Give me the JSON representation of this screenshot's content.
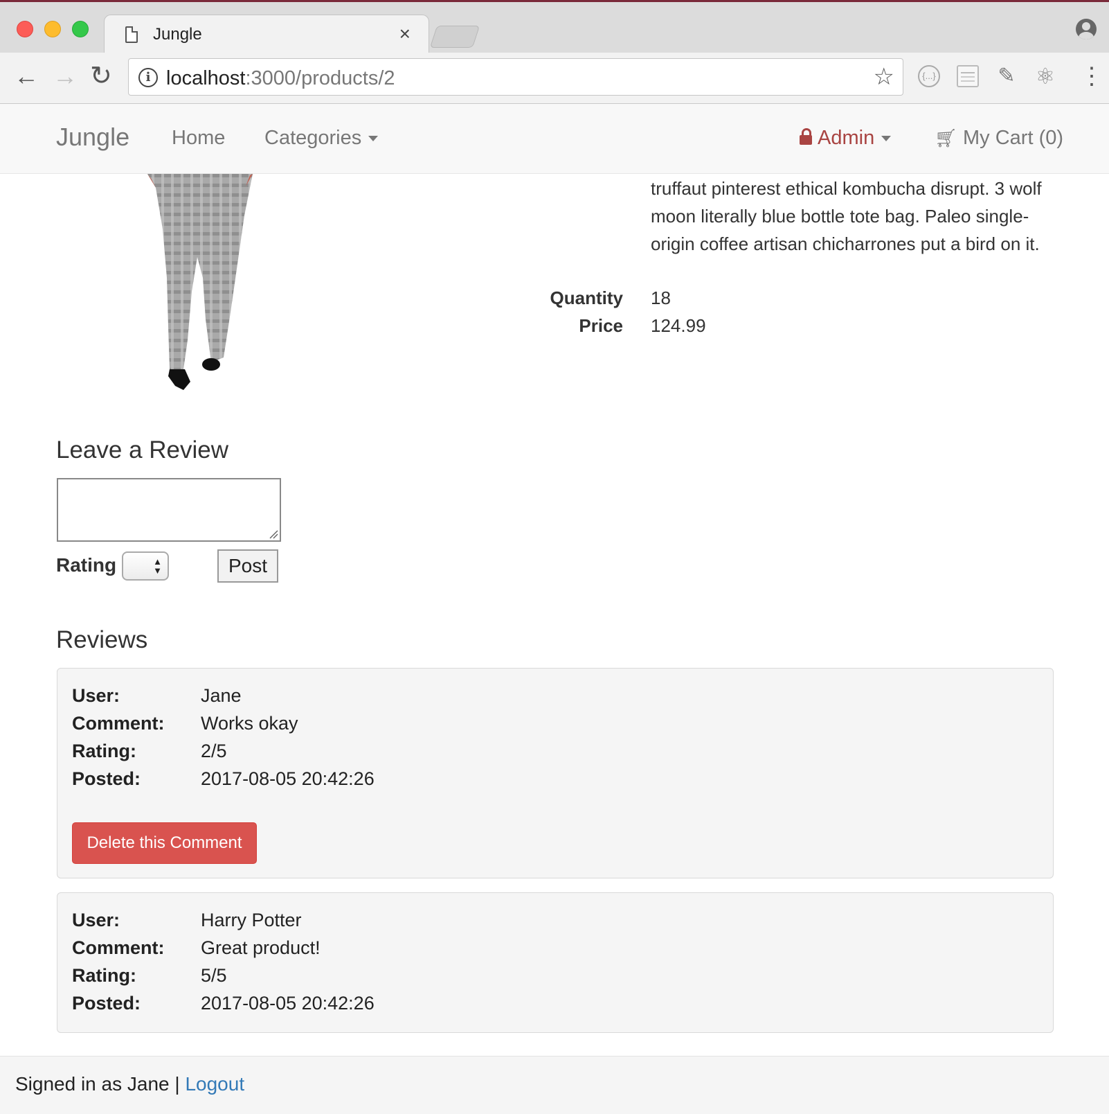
{
  "browser": {
    "tab_title": "Jungle",
    "tab_close": "×",
    "url_host": "localhost",
    "url_path": ":3000/products/2",
    "back_glyph": "←",
    "forward_glyph": "→",
    "reload_glyph": "↻",
    "star_glyph": "☆",
    "menu_glyph": "⋮",
    "icons": [
      "back-arrow-icon",
      "forward-arrow-icon",
      "reload-icon",
      "info-icon",
      "bookmark-star-icon",
      "json-viewer-extension-icon",
      "page-extension-icon",
      "eyedropper-extension-icon",
      "react-devtools-icon",
      "chrome-menu-icon",
      "profile-icon"
    ]
  },
  "navbar": {
    "brand": "Jungle",
    "home": "Home",
    "categories": "Categories",
    "admin": "Admin",
    "cart": "My Cart (0)",
    "admin_color": "#a94442"
  },
  "product": {
    "description": "truffaut pinterest ethical kombucha disrupt. 3 wolf moon literally blue bottle tote bag. Paleo single-origin coffee artisan chicharrones put a bird on it.",
    "quantity_label": "Quantity",
    "quantity": "18",
    "price_label": "Price",
    "price": "124.99"
  },
  "review_form": {
    "heading": "Leave a Review",
    "comment_value": "",
    "rating_label": "Rating",
    "rating_value": "",
    "post_label": "Post"
  },
  "reviews": {
    "heading": "Reviews",
    "keys": {
      "user": "User:",
      "comment": "Comment:",
      "rating": "Rating:",
      "posted": "Posted:"
    },
    "items": [
      {
        "user": "Jane",
        "comment": "Works okay",
        "rating": "2/5",
        "posted": "2017-08-05 20:42:26",
        "delete_label": "Delete this Comment"
      },
      {
        "user": "Harry Potter",
        "comment": "Great product!",
        "rating": "5/5",
        "posted": "2017-08-05 20:42:26"
      }
    ],
    "delete_color": "#d9534f"
  },
  "footer": {
    "signed_in_text": "Signed in as Jane |",
    "logout": "Logout",
    "link_color": "#337ab7"
  }
}
